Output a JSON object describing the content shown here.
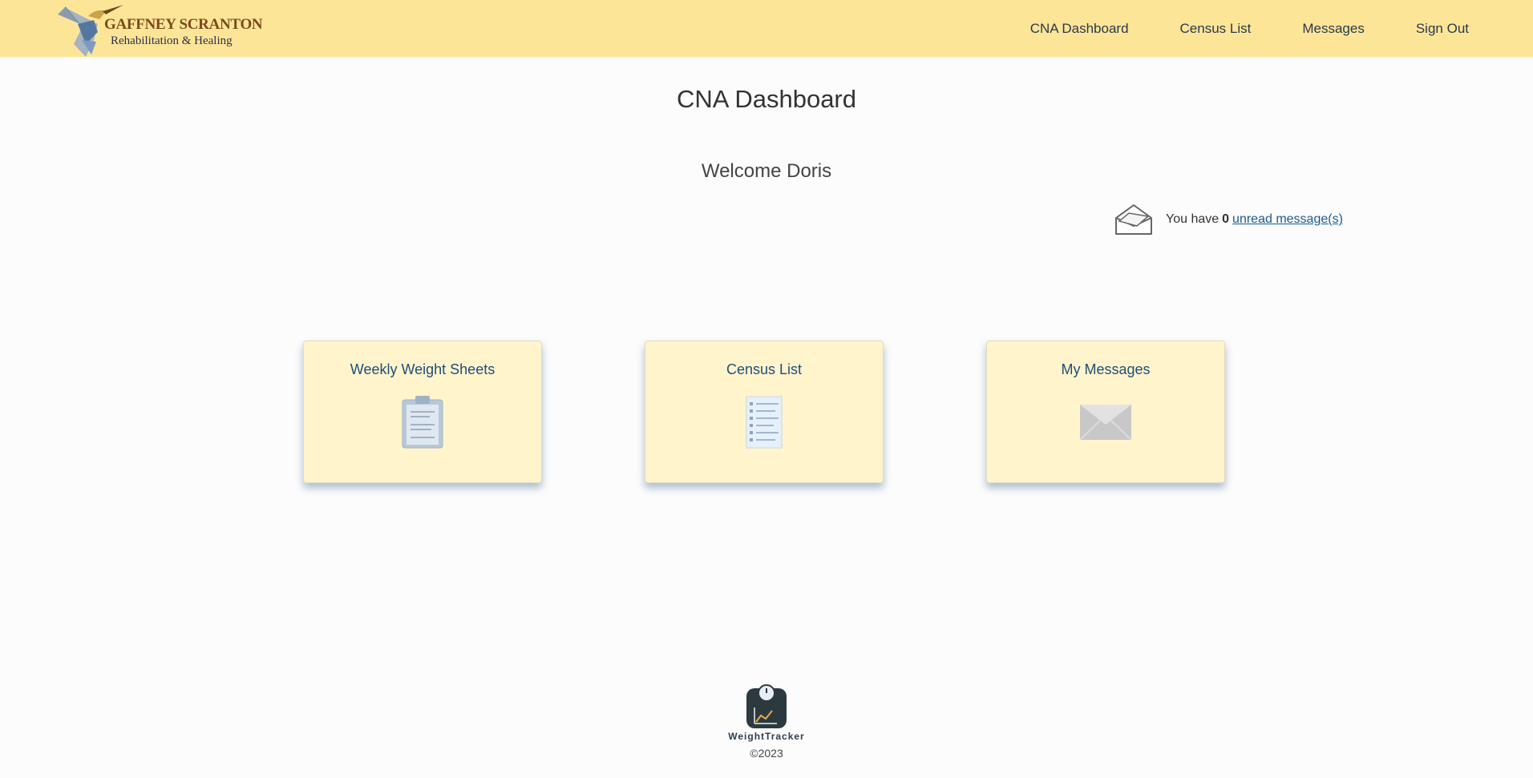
{
  "header": {
    "logo_title": "GAFFNEY SCRANTON",
    "logo_subtitle": "Rehabilitation & Healing",
    "nav": [
      {
        "label": "CNA Dashboard"
      },
      {
        "label": "Census List"
      },
      {
        "label": "Messages"
      },
      {
        "label": "Sign Out"
      }
    ]
  },
  "main": {
    "title": "CNA Dashboard",
    "welcome": "Welcome Doris",
    "messages_notice": {
      "prefix": "You have",
      "count": "0",
      "link": "unread message(s)"
    },
    "cards": [
      {
        "title": "Weekly Weight Sheets",
        "icon": "clipboard-icon"
      },
      {
        "title": "Census List",
        "icon": "list-document-icon"
      },
      {
        "title": "My Messages",
        "icon": "envelope-icon"
      }
    ]
  },
  "footer": {
    "brand": "WeightTracker",
    "copyright": "©2023"
  },
  "colors": {
    "header_bg": "#fde598",
    "card_bg": "#fff4cc",
    "link": "#1d5a8c",
    "card_title": "#1f4e79"
  }
}
